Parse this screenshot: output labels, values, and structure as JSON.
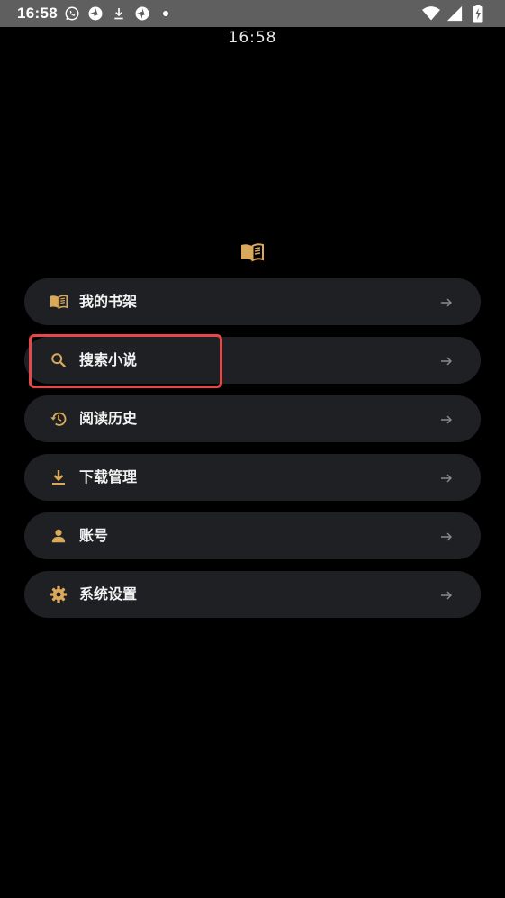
{
  "status_bar": {
    "time": "16:58",
    "left_icons": [
      "whatsapp-icon",
      "pinwheel-icon",
      "download-icon",
      "pinwheel-icon",
      "dot-icon"
    ],
    "right_icons": [
      "wifi-icon",
      "signal-icon",
      "battery-charging-icon"
    ]
  },
  "clock": {
    "time": "16:58"
  },
  "logo": {
    "icon": "open-book-icon"
  },
  "menu": {
    "items": [
      {
        "label": "我的书架",
        "icon": "open-book-icon"
      },
      {
        "label": "搜索小说",
        "icon": "search-icon"
      },
      {
        "label": "阅读历史",
        "icon": "history-icon"
      },
      {
        "label": "下载管理",
        "icon": "download-icon"
      },
      {
        "label": "账号",
        "icon": "person-icon"
      },
      {
        "label": "系统设置",
        "icon": "gear-icon"
      }
    ]
  },
  "colors": {
    "background": "#000000",
    "card": "#1f2024",
    "accent": "#d9a85a",
    "text": "#f2f2f2",
    "arrow": "#8a8a8a",
    "highlight": "#e8474a"
  }
}
